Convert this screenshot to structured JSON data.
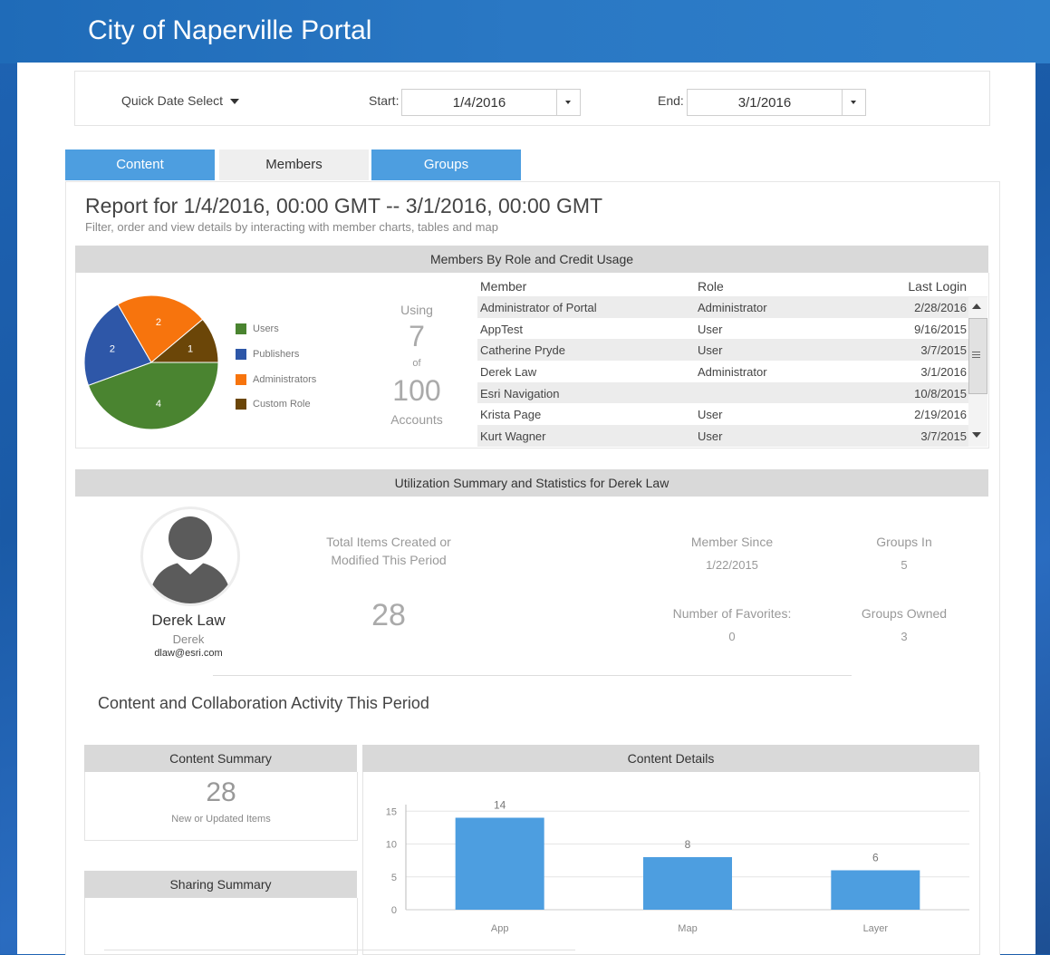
{
  "header": {
    "title": "City of Naperville Portal"
  },
  "date_filter": {
    "quick_select": "Quick Date Select",
    "start_label": "Start:",
    "start_value": "1/4/2016",
    "end_label": "End:",
    "end_value": "3/1/2016"
  },
  "tabs": [
    {
      "label": "Content",
      "state": "inactive"
    },
    {
      "label": "Members",
      "state": "selected"
    },
    {
      "label": "Groups",
      "state": "inactive"
    }
  ],
  "report": {
    "title": "Report for 1/4/2016, 00:00 GMT -- 3/1/2016, 00:00 GMT",
    "subtitle": "Filter, order and view details by interacting with member charts, tables and map"
  },
  "members_section": {
    "title": "Members By Role and Credit Usage",
    "pie": {
      "slices": [
        {
          "name": "Users",
          "value": 4,
          "color": "#4a8430"
        },
        {
          "name": "Publishers",
          "value": 2,
          "color": "#2e57a8"
        },
        {
          "name": "Administrators",
          "value": 2,
          "color": "#f7740d"
        },
        {
          "name": "Custom Role",
          "value": 1,
          "color": "#6b4608"
        }
      ]
    },
    "usage": {
      "using": "Using",
      "count": "7",
      "of": "of",
      "total": "100",
      "accounts": "Accounts"
    },
    "table": {
      "headers": [
        "Member",
        "Role",
        "Last Login"
      ],
      "rows": [
        [
          "Administrator of Portal",
          "Administrator",
          "2/28/2016"
        ],
        [
          "AppTest",
          "User",
          "9/16/2015"
        ],
        [
          "Catherine Pryde",
          "User",
          "3/7/2015"
        ],
        [
          "Derek Law",
          "Administrator",
          "3/1/2016"
        ],
        [
          "Esri Navigation",
          "",
          "10/8/2015"
        ],
        [
          "Krista Page",
          "User",
          "2/19/2016"
        ],
        [
          "Kurt Wagner",
          "User",
          "3/7/2015"
        ]
      ]
    }
  },
  "utilization": {
    "title": "Utilization Summary and Statistics for Derek Law",
    "user": {
      "name": "Derek Law",
      "username": "Derek",
      "email": "dlaw@esri.com"
    },
    "items_label_1": "Total Items Created or",
    "items_label_2": "Modified This Period",
    "items_value": "28",
    "member_since_label": "Member Since",
    "member_since_value": "1/22/2015",
    "groups_in_label": "Groups In",
    "groups_in_value": "5",
    "favorites_label": "Number of Favorites:",
    "favorites_value": "0",
    "groups_owned_label": "Groups Owned",
    "groups_owned_value": "3"
  },
  "activity": {
    "title": "Content and Collaboration Activity This Period",
    "content_summary": {
      "title": "Content Summary",
      "value": "28",
      "caption": "New or Updated Items"
    },
    "sharing_summary": {
      "title": "Sharing Summary"
    },
    "content_details": {
      "title": "Content Details"
    }
  },
  "chart_data": {
    "type": "bar",
    "categories": [
      "App",
      "Map",
      "Layer"
    ],
    "values": [
      14,
      8,
      6
    ],
    "data_labels": [
      "14",
      "8",
      "6"
    ],
    "yticks": [
      "0",
      "5",
      "10",
      "15"
    ],
    "ylim": [
      0,
      16
    ],
    "bar_color": "#4d9ee0",
    "grid": true
  }
}
